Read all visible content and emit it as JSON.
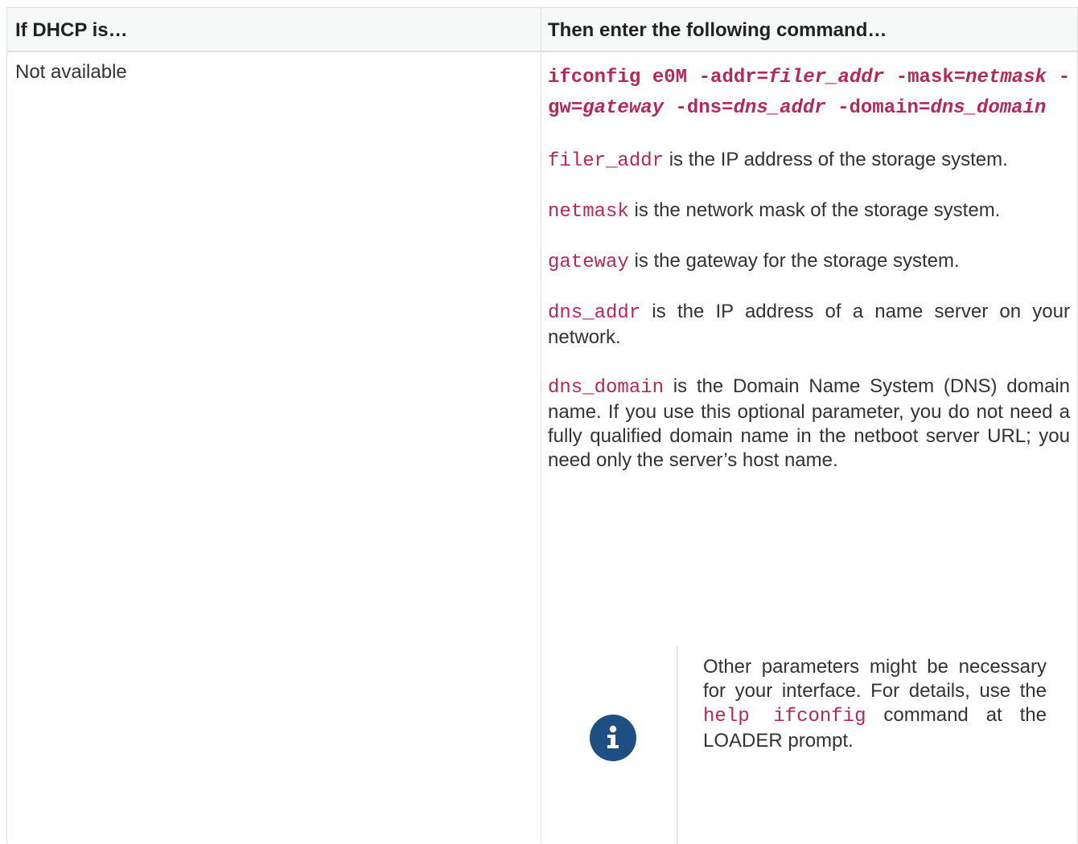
{
  "table": {
    "headers": [
      "If DHCP is…",
      "Then enter the following command…"
    ],
    "row": {
      "condition": "Not available",
      "command": {
        "parts": [
          {
            "text": "ifconfig e0M -addr=",
            "var": false
          },
          {
            "text": "filer_addr",
            "var": true
          },
          {
            "text": " -mask=",
            "var": false
          },
          {
            "text": "netmask",
            "var": true
          },
          {
            "text": " -gw=",
            "var": false
          },
          {
            "text": "gateway",
            "var": true
          },
          {
            "text": " -dns=",
            "var": false
          },
          {
            "text": "dns_addr",
            "var": true
          },
          {
            "text": " -domain=",
            "var": false
          },
          {
            "text": "dns_domain",
            "var": true
          }
        ]
      },
      "params": [
        {
          "name": "filer_addr",
          "desc": " is the IP address of the storage system."
        },
        {
          "name": "netmask",
          "desc": " is the network mask of the storage system."
        },
        {
          "name": "gateway",
          "desc": " is the gateway for the storage system."
        },
        {
          "name": "dns_addr",
          "desc": " is the IP address of a name server on your network."
        },
        {
          "name": "dns_domain",
          "desc": " is the Domain Name System (DNS) domain name. If you use this optional parameter, you do not need a fully qualified domain name in the netboot server URL; you need only the server’s host name."
        }
      ],
      "note": {
        "icon": "info-icon",
        "before": "Other parameters might be necessary for your interface. For details, use the ",
        "code": "help ifconfig",
        "after": " command at the LOADER prompt."
      }
    }
  },
  "colors": {
    "code": "#b42a55",
    "header_bg": "#f7f8f8",
    "border": "#dedede",
    "icon": "#1f4f82"
  }
}
